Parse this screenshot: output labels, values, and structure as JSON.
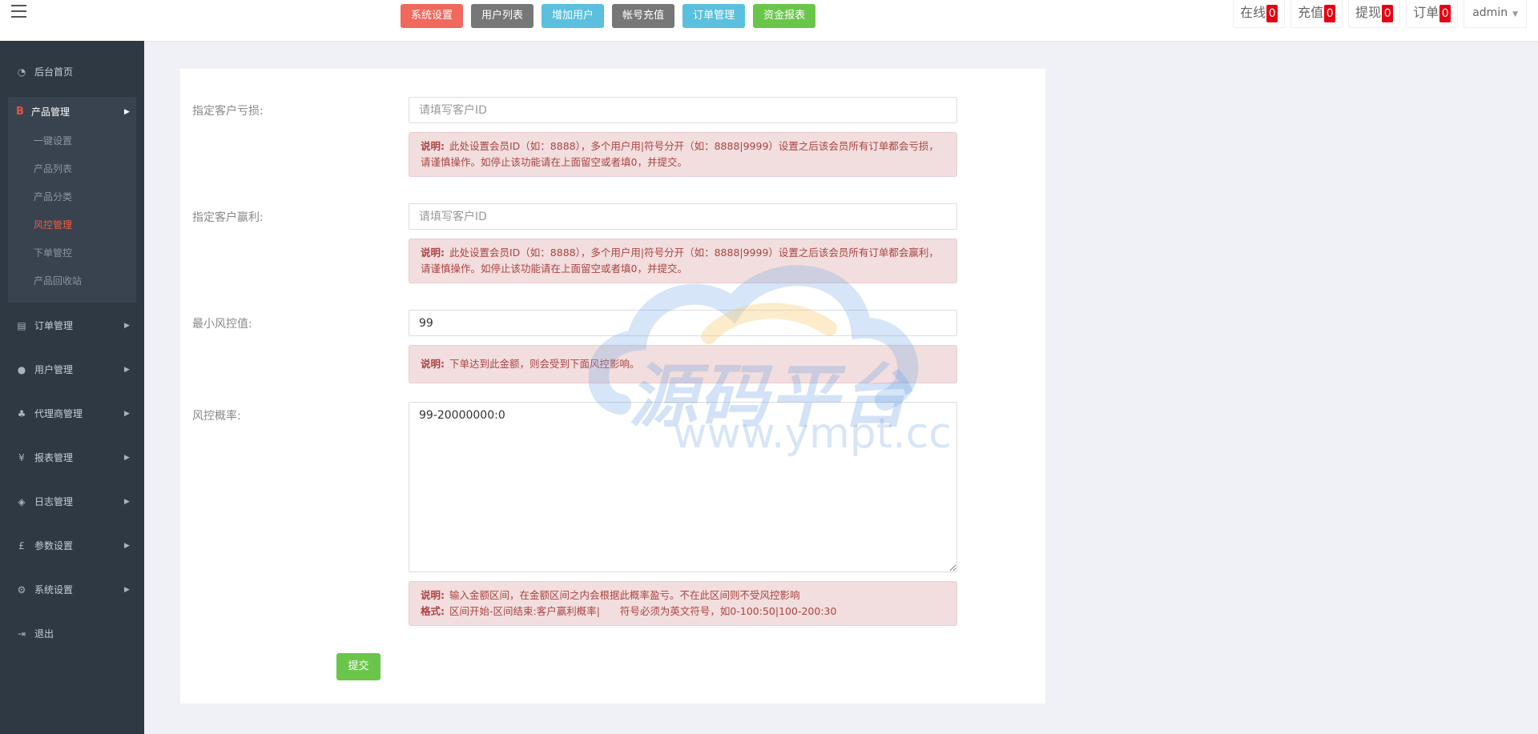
{
  "header": {
    "buttons": [
      {
        "label": "系统设置",
        "color": "#f0695c"
      },
      {
        "label": "用户列表",
        "color": "#777777"
      },
      {
        "label": "增加用户",
        "color": "#5bc0de"
      },
      {
        "label": "帐号充值",
        "color": "#777777"
      },
      {
        "label": "订单管理",
        "color": "#5bc0de"
      },
      {
        "label": "资金报表",
        "color": "#6ac64a"
      }
    ],
    "stats": [
      {
        "label": "在线",
        "count": "0"
      },
      {
        "label": "充值",
        "count": "0"
      },
      {
        "label": "提现",
        "count": "0"
      },
      {
        "label": "订单",
        "count": "0"
      }
    ],
    "user": "admin"
  },
  "sidebar": {
    "home": "后台首页",
    "product": {
      "label": "产品管理",
      "icon_char": "B",
      "items": [
        "一键设置",
        "产品列表",
        "产品分类",
        "风控管理",
        "下单管控",
        "产品回收站"
      ],
      "active": "风控管理"
    },
    "items": [
      {
        "label": "订单管理",
        "icon": "copy-icon",
        "icon_char": "▤"
      },
      {
        "label": "用户管理",
        "icon": "user-icon",
        "icon_char": "●"
      },
      {
        "label": "代理商管理",
        "icon": "sitemap-icon",
        "icon_char": "♣"
      },
      {
        "label": "报表管理",
        "icon": "yen-icon",
        "icon_char": "¥"
      },
      {
        "label": "日志管理",
        "icon": "tags-icon",
        "icon_char": "◈"
      },
      {
        "label": "参数设置",
        "icon": "pound-icon",
        "icon_char": "£"
      },
      {
        "label": "系统设置",
        "icon": "cogs-icon",
        "icon_char": "⚙"
      }
    ],
    "logout": "退出"
  },
  "form": {
    "loss": {
      "label": "指定客户亏损:",
      "placeholder": "请填写客户ID",
      "note_title": "说明:",
      "note": "此处设置会员ID（如：8888），多个用户用|符号分开（如：8888|9999）设置之后该会员所有订单都会亏损，请谨慎操作。如停止该功能请在上面留空或者填0，并提交。"
    },
    "profit": {
      "label": "指定客户赢利:",
      "placeholder": "请填写客户ID",
      "note_title": "说明:",
      "note": "此处设置会员ID（如：8888），多个用户用|符号分开（如：8888|9999）设置之后该会员所有订单都会赢利，请谨慎操作。如停止该功能请在上面留空或者填0，并提交。"
    },
    "min_risk": {
      "label": "最小风控值:",
      "value": "99",
      "note_title": "说明:",
      "note": "下单达到此金额，则会受到下面风控影响。"
    },
    "risk_rate": {
      "label": "风控概率:",
      "value": "99-20000000:0",
      "note_title": "说明:",
      "note": "输入金额区间，在金额区间之内会根据此概率盈亏。不在此区间则不受风控影响",
      "format_title": "格式:",
      "format": "区间开始-区间结束:客户赢利概率|　　符号必须为英文符号，如0-100:50|100-200:30"
    },
    "submit": "提交"
  },
  "watermark": {
    "text": "源码平台",
    "url": "www.ympt.cc"
  }
}
